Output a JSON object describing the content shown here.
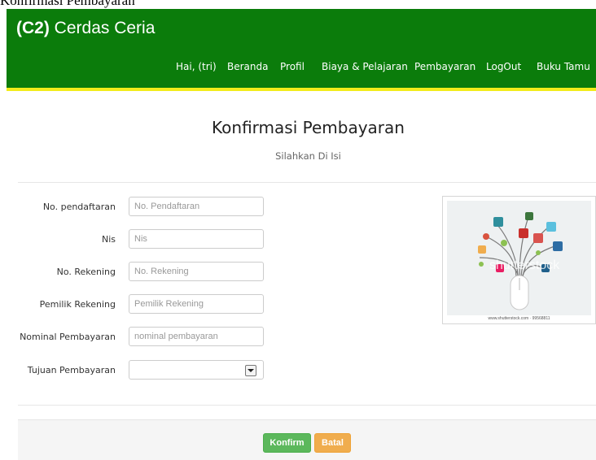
{
  "tab": {
    "title": "Konfirmasi Pembayaran"
  },
  "navbar": {
    "brand_bold": "(C2)",
    "brand_rest": " Cerdas Ceria",
    "menu": [
      "Hai, (tri)",
      "Beranda",
      "Profil",
      "Biaya & Pelajaran",
      "Pembayaran",
      "LogOut",
      "Buku Tamu"
    ]
  },
  "heading": {
    "title": "Konfirmasi Pembayaran",
    "subtitle": "Silahkan Di Isi"
  },
  "form": {
    "fields": [
      {
        "label": "No. pendaftaran",
        "placeholder": "No. Pendaftaran"
      },
      {
        "label": "Nis",
        "placeholder": "Nis"
      },
      {
        "label": "No. Rekening",
        "placeholder": "No. Rekening"
      },
      {
        "label": "Pemilik Rekening",
        "placeholder": "Pemilik Rekening"
      },
      {
        "label": "Nominal Pembayaran",
        "placeholder": "nominal pembayaran"
      },
      {
        "label": "Tujuan Pembayaran",
        "value": ""
      }
    ],
    "confirm_label": "Konfirm",
    "cancel_label": "Batal"
  },
  "image": {
    "watermark": "shutterstock",
    "caption": "www.shutterstock.com · 99568811"
  },
  "colors": {
    "navbar": "#0b7c0b",
    "navbar_border": "#f2ec1a",
    "confirm": "#5cb85c",
    "cancel": "#f0ad4e"
  }
}
